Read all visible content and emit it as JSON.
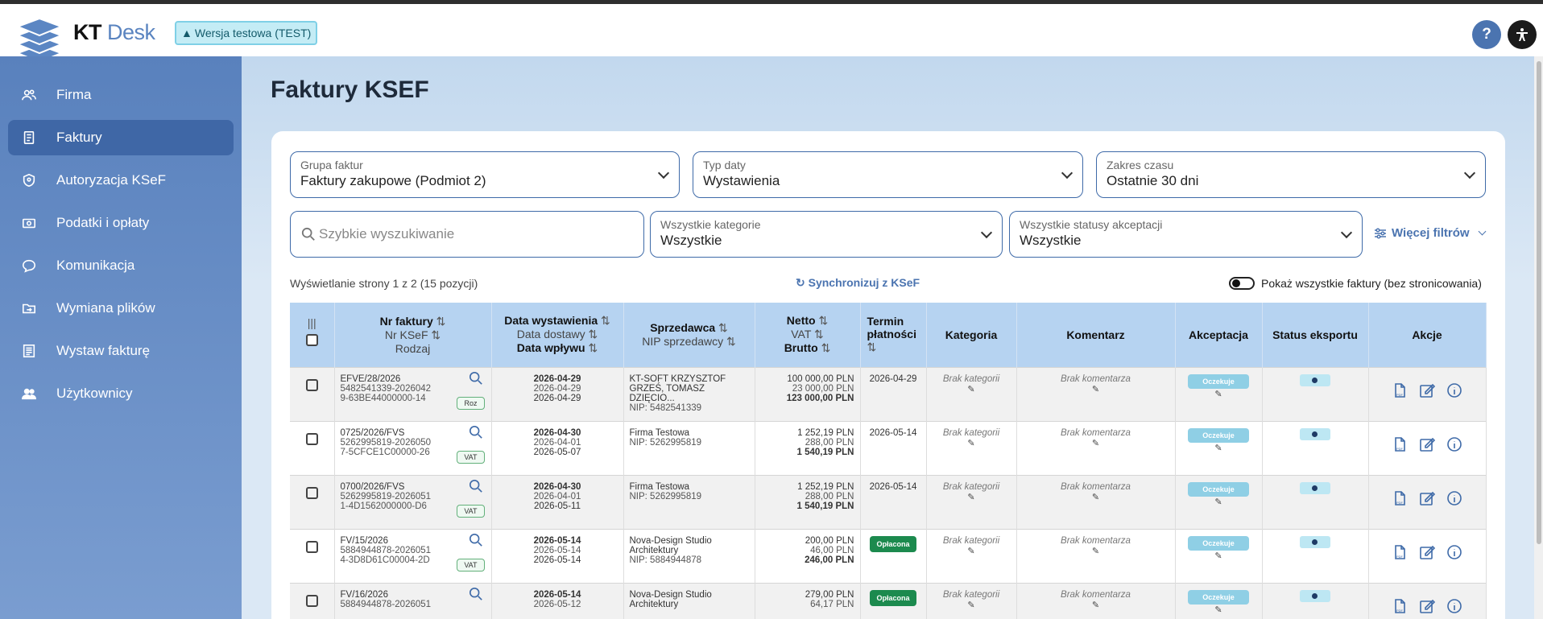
{
  "app": {
    "brand_1": "KT",
    "brand_2": "Desk",
    "test_badge": "Wersja testowa (TEST)",
    "help": "?"
  },
  "sidebar": {
    "items": [
      {
        "label": "Firma",
        "icon": "users-icon"
      },
      {
        "label": "Faktury",
        "icon": "document-icon",
        "active": true
      },
      {
        "label": "Autoryzacja KSeF",
        "icon": "shield-icon"
      },
      {
        "label": "Podatki i opłaty",
        "icon": "money-icon"
      },
      {
        "label": "Komunikacja",
        "icon": "chat-icon"
      },
      {
        "label": "Wymiana plików",
        "icon": "folder-icon"
      },
      {
        "label": "Wystaw fakturę",
        "icon": "invoice-icon"
      },
      {
        "label": "Użytkownicy",
        "icon": "user-group-icon"
      }
    ]
  },
  "page": {
    "title": "Faktury KSEF"
  },
  "filters": {
    "group": {
      "label": "Grupa faktur",
      "value": "Faktury zakupowe (Podmiot 2)"
    },
    "date_type": {
      "label": "Typ daty",
      "value": "Wystawienia"
    },
    "range": {
      "label": "Zakres czasu",
      "value": "Ostatnie 30 dni"
    },
    "search_placeholder": "Szybkie wyszukiwanie",
    "category": {
      "label": "Wszystkie kategorie",
      "value": "Wszystkie"
    },
    "acceptance": {
      "label": "Wszystkie statusy akceptacji",
      "value": "Wszystkie"
    },
    "more": "Więcej filtrów"
  },
  "listing": {
    "info": "Wyświetlanie strony 1 z 2 (15 pozycji)",
    "sync": "Synchronizuj z KSeF",
    "toggle_label": "Pokaż wszystkie faktury (bez stronicowania)"
  },
  "table": {
    "headers": {
      "nr": "Nr faktury",
      "nr_ksef": "Nr KSeF",
      "kind": "Rodzaj",
      "issue": "Data wystawienia",
      "delivery": "Data dostawy",
      "inflow": "Data wpływu",
      "seller": "Sprzedawca",
      "seller_nip": "NIP sprzedawcy",
      "net": "Netto",
      "vat": "VAT",
      "gross": "Brutto",
      "due": "Termin płatności",
      "category": "Kategoria",
      "comment": "Komentarz",
      "acceptance": "Akceptacja",
      "export": "Status eksportu",
      "actions": "Akcje",
      "columns_icon": "|||"
    },
    "rows": [
      {
        "nr": "EFVE/28/2026",
        "ksef1": "5482541339-2026042",
        "ksef2": "9-63BE44000000-14",
        "kind": "Roz",
        "issue": "2026-04-29",
        "delivery": "2026-04-29",
        "inflow": "2026-04-29",
        "seller1": "KT-SOFT KRZYSZTOF",
        "seller2": "GRZEŚ, TOMASZ DZIĘCIO...",
        "nip": "NIP: 5482541339",
        "net": "100 000,00 PLN",
        "vat": "23 000,00 PLN",
        "gross": "123 000,00 PLN",
        "due": "2026-04-29",
        "paid": "",
        "category": "Brak kategorii",
        "comment": "Brak komentarza",
        "acceptance": "Oczekuje"
      },
      {
        "nr": "0725/2026/FVS",
        "ksef1": "5262995819-2026050",
        "ksef2": "7-5CFCE1C00000-26",
        "kind": "VAT",
        "issue": "2026-04-30",
        "delivery": "2026-04-01",
        "inflow": "2026-05-07",
        "seller1": "Firma Testowa",
        "seller2": "",
        "nip": "NIP: 5262995819",
        "net": "1 252,19 PLN",
        "vat": "288,00 PLN",
        "gross": "1 540,19 PLN",
        "due": "2026-05-14",
        "paid": "",
        "category": "Brak kategorii",
        "comment": "Brak komentarza",
        "acceptance": "Oczekuje"
      },
      {
        "nr": "0700/2026/FVS",
        "ksef1": "5262995819-2026051",
        "ksef2": "1-4D1562000000-D6",
        "kind": "VAT",
        "issue": "2026-04-30",
        "delivery": "2026-04-01",
        "inflow": "2026-05-11",
        "seller1": "Firma Testowa",
        "seller2": "",
        "nip": "NIP: 5262995819",
        "net": "1 252,19 PLN",
        "vat": "288,00 PLN",
        "gross": "1 540,19 PLN",
        "due": "2026-05-14",
        "paid": "",
        "category": "Brak kategorii",
        "comment": "Brak komentarza",
        "acceptance": "Oczekuje"
      },
      {
        "nr": "FV/15/2026",
        "ksef1": "5884944878-2026051",
        "ksef2": "4-3D8D61C00004-2D",
        "kind": "VAT",
        "issue": "2026-05-14",
        "delivery": "2026-05-14",
        "inflow": "2026-05-14",
        "seller1": "Nova-Design Studio",
        "seller2": "Architektury",
        "nip": "NIP: 5884944878",
        "net": "200,00 PLN",
        "vat": "46,00 PLN",
        "gross": "246,00 PLN",
        "due": "",
        "paid": "Opłacona",
        "category": "Brak kategorii",
        "comment": "Brak komentarza",
        "acceptance": "Oczekuje"
      },
      {
        "nr": "FV/16/2026",
        "ksef1": "5884944878-2026051",
        "ksef2": "",
        "kind": "",
        "issue": "2026-05-14",
        "delivery": "2026-05-12",
        "inflow": "",
        "seller1": "Nova-Design Studio",
        "seller2": "Architektury",
        "nip": "",
        "net": "279,00 PLN",
        "vat": "64,17 PLN",
        "gross": "",
        "due": "",
        "paid": "Opłacona",
        "category": "Brak kategorii",
        "comment": "Brak komentarza",
        "acceptance": "Oczekuje"
      }
    ]
  },
  "colors": {
    "sidebar": "#5981bd",
    "active": "#3f67a6",
    "header_row": "#b6d3f1",
    "paid": "#1c8a4e",
    "accent": "#4b74b0"
  }
}
